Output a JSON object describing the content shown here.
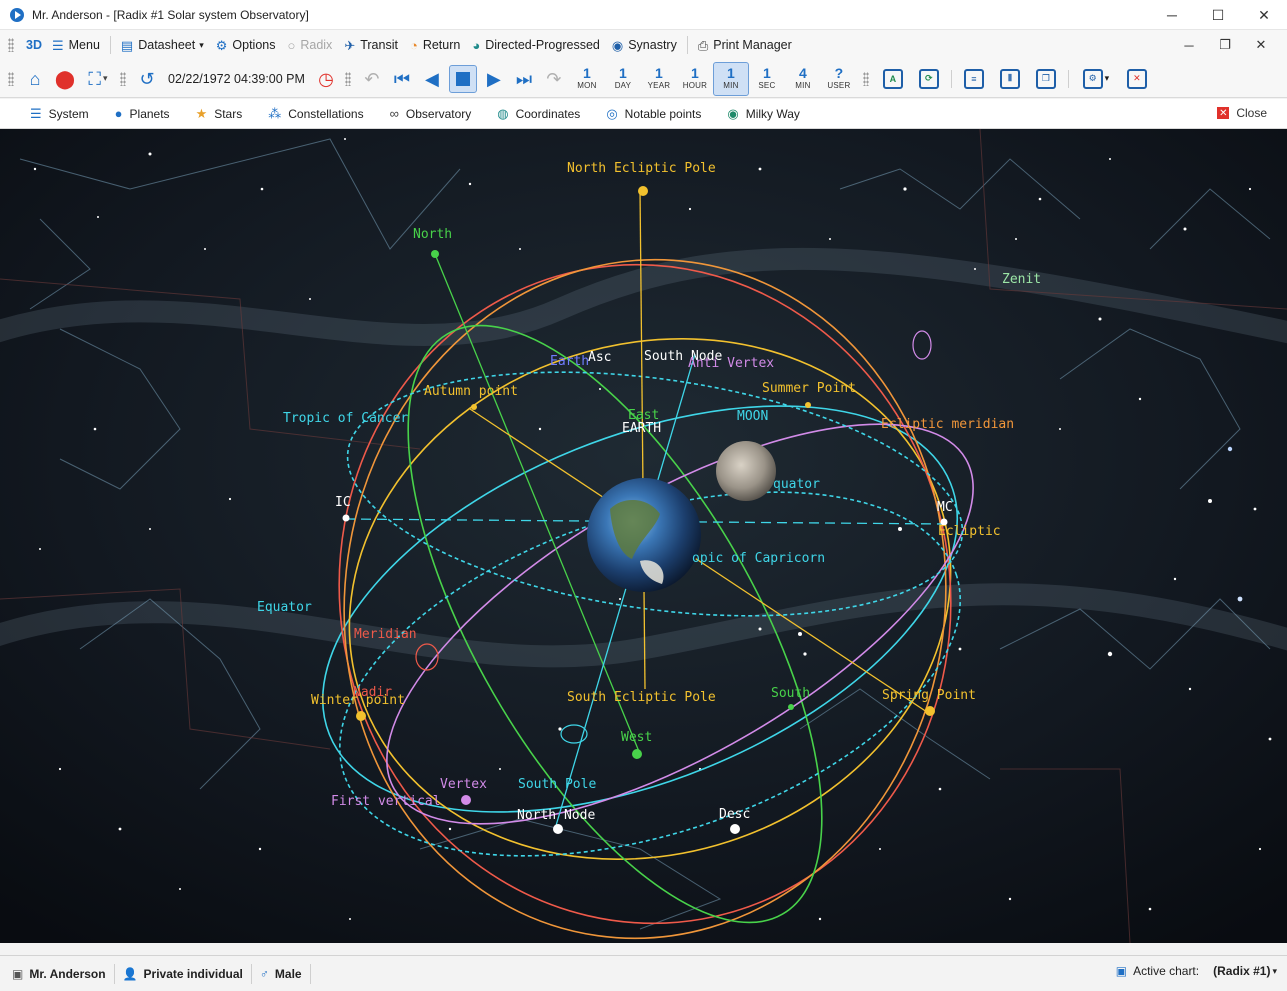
{
  "window": {
    "title": "Mr. Anderson - [Radix #1 Solar system Observatory]",
    "minimize": "─",
    "maximize": "☐",
    "close": "✕"
  },
  "toolbar1": {
    "view_3d": "3D",
    "menu": "Menu",
    "datasheet": "Datasheet",
    "options": "Options",
    "radix": "Radix",
    "transit": "Transit",
    "return": "Return",
    "directed_progressed": "Directed-Progressed",
    "synastry": "Synastry",
    "print_manager": "Print Manager"
  },
  "toolbar2": {
    "datetime": "02/22/1972 04:39:00 PM",
    "steps": [
      {
        "num": "1",
        "label": "MON"
      },
      {
        "num": "1",
        "label": "DAY"
      },
      {
        "num": "1",
        "label": "YEAR"
      },
      {
        "num": "1",
        "label": "HOUR"
      },
      {
        "num": "1",
        "label": "MIN"
      },
      {
        "num": "1",
        "label": "SEC"
      },
      {
        "num": "4",
        "label": "MIN"
      },
      {
        "num": "?",
        "label": "USER"
      }
    ],
    "active_step": "MIN"
  },
  "tabs": {
    "system": "System",
    "planets": "Planets",
    "stars": "Stars",
    "constellations": "Constellations",
    "observatory": "Observatory",
    "coordinates": "Coordinates",
    "notable_points": "Notable points",
    "milky_way": "Milky Way",
    "close": "Close"
  },
  "viewport": {
    "labels": {
      "north_ecliptic_pole": "North Ecliptic Pole",
      "north": "North",
      "zenit": "Zenit",
      "earth_small": "Earth",
      "asc": "Asc",
      "south_node": "South Node",
      "anti_vertex": "Anti Vertex",
      "autumn_point": "Autumn point",
      "summer_point": "Summer Point",
      "tropic_cancer": "Tropic of Cancer",
      "east": "East",
      "earth_big": "EARTH",
      "moon": "MOON",
      "ecliptic_meridian": "Ecliptic meridian",
      "equator_right": "quator",
      "ic": "IC",
      "mc": "MC",
      "ecliptic": "Ecliptic",
      "tropic_capricorn": "opic of Capricorn",
      "equator_left": "Equator",
      "meridian": "Meridian",
      "nadir": "Nadir",
      "winter_point": "Winter point",
      "south_ecliptic_pole": "South Ecliptic Pole",
      "south": "South",
      "spring_point": "Spring Point",
      "west": "West",
      "vertex": "Vertex",
      "south_pole": "South Pole",
      "first_vertical": "First vertical",
      "north_node": "North Node",
      "desc": "Desc"
    }
  },
  "statusbar": {
    "name": "Mr. Anderson",
    "type": "Private individual",
    "gender": "Male",
    "active_chart_label": "Active chart:",
    "active_chart_value": "(Radix #1)"
  },
  "colors": {
    "accent": "#1f6fc4",
    "cyan": "#3fd6e8",
    "yellow": "#f2c12e",
    "orange": "#f0963a",
    "green": "#48d24a",
    "red": "#ef5a4a",
    "violet": "#d28be8"
  }
}
